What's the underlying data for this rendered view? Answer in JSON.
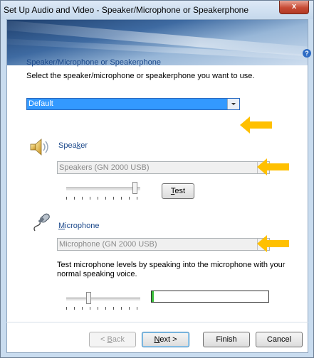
{
  "window": {
    "title": "Set Up Audio and Video - Speaker/Microphone or Speakerphone",
    "close_label": "x",
    "help_label": "?"
  },
  "section": {
    "title": "Speaker/Microphone or Speakerphone",
    "instruction": "Select the speaker/microphone or speakerphone you want to use."
  },
  "device_select": {
    "value": "Default"
  },
  "speaker": {
    "label_pre": "Spea",
    "label_key": "k",
    "label_post": "er",
    "device_value": "Speakers (GN 2000 USB)",
    "volume_level": 0.92
  },
  "test_button": {
    "key": "T",
    "rest": "est"
  },
  "microphone": {
    "label_key": "M",
    "label_rest": "icrophone",
    "device_value": "Microphone (GN 2000 USB)",
    "instruction": "Test microphone levels by speaking into the microphone with your normal speaking voice.",
    "volume_level": 0.3,
    "meter_level": 0.02
  },
  "footer": {
    "back_pre": "< ",
    "back_key": "B",
    "back_post": "ack",
    "next_key": "N",
    "next_post": "ext >",
    "finish_label": "Finish",
    "cancel_label": "Cancel"
  },
  "colors": {
    "accent_arrow": "#ffc000",
    "selection": "#3399ff",
    "link_blue": "#1d4a8c"
  }
}
